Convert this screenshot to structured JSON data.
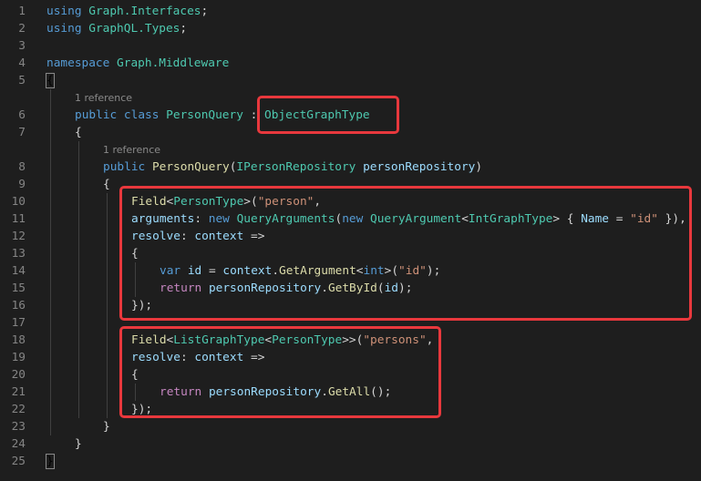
{
  "editor": {
    "highlight_color": "#e8383d",
    "rows": [
      {
        "n": "1",
        "indent": 0,
        "t": [
          [
            "kw",
            "using "
          ],
          [
            "ty",
            "Graph.Interfaces"
          ],
          [
            "pl",
            ";"
          ]
        ]
      },
      {
        "n": "2",
        "indent": 0,
        "t": [
          [
            "kw",
            "using "
          ],
          [
            "ty",
            "GraphQL.Types"
          ],
          [
            "pl",
            ";"
          ]
        ]
      },
      {
        "n": "3",
        "indent": 0,
        "t": []
      },
      {
        "n": "4",
        "indent": 0,
        "t": [
          [
            "kw",
            "namespace "
          ],
          [
            "ty",
            "Graph.Middleware"
          ]
        ]
      },
      {
        "n": "5",
        "indent": 0,
        "t": [
          [
            "bm",
            "{"
          ]
        ]
      },
      {
        "lens": "1 reference",
        "indent": 1
      },
      {
        "n": "6",
        "indent": 1,
        "t": [
          [
            "kw",
            "public class "
          ],
          [
            "ty",
            "PersonQuery"
          ],
          [
            "pl",
            " : "
          ],
          [
            "ty",
            "ObjectGraphType"
          ]
        ]
      },
      {
        "n": "7",
        "indent": 1,
        "t": [
          [
            "pl",
            "{"
          ]
        ]
      },
      {
        "lens": "1 reference",
        "indent": 2
      },
      {
        "n": "8",
        "indent": 2,
        "t": [
          [
            "kw",
            "public "
          ],
          [
            "fn",
            "PersonQuery"
          ],
          [
            "pl",
            "("
          ],
          [
            "ty",
            "IPersonRepository "
          ],
          [
            "var",
            "personRepository"
          ],
          [
            "pl",
            ")"
          ]
        ]
      },
      {
        "n": "9",
        "indent": 2,
        "t": [
          [
            "pl",
            "{"
          ]
        ]
      },
      {
        "n": "10",
        "indent": 3,
        "t": [
          [
            "fn",
            "Field"
          ],
          [
            "pl",
            "<"
          ],
          [
            "ty",
            "PersonType"
          ],
          [
            "pl",
            ">("
          ],
          [
            "str",
            "\"person\""
          ],
          [
            "pl",
            ","
          ]
        ]
      },
      {
        "n": "11",
        "indent": 3,
        "t": [
          [
            "var",
            "arguments"
          ],
          [
            "pl",
            ": "
          ],
          [
            "kw",
            "new "
          ],
          [
            "ty",
            "QueryArguments"
          ],
          [
            "pl",
            "("
          ],
          [
            "kw",
            "new "
          ],
          [
            "ty",
            "QueryArgument"
          ],
          [
            "pl",
            "<"
          ],
          [
            "ty",
            "IntGraphType"
          ],
          [
            "pl",
            "> { "
          ],
          [
            "var",
            "Name"
          ],
          [
            "pl",
            " = "
          ],
          [
            "str",
            "\"id\""
          ],
          [
            "pl",
            " }),"
          ]
        ]
      },
      {
        "n": "12",
        "indent": 3,
        "t": [
          [
            "var",
            "resolve"
          ],
          [
            "pl",
            ": "
          ],
          [
            "var",
            "context"
          ],
          [
            "pl",
            " =>"
          ]
        ]
      },
      {
        "n": "13",
        "indent": 3,
        "t": [
          [
            "pl",
            "{"
          ]
        ]
      },
      {
        "n": "14",
        "indent": 4,
        "t": [
          [
            "kw",
            "var "
          ],
          [
            "var",
            "id"
          ],
          [
            "pl",
            " = "
          ],
          [
            "var",
            "context"
          ],
          [
            "pl",
            "."
          ],
          [
            "fn",
            "GetArgument"
          ],
          [
            "pl",
            "<"
          ],
          [
            "kw",
            "int"
          ],
          [
            "pl",
            ">("
          ],
          [
            "str",
            "\"id\""
          ],
          [
            "pl",
            ");"
          ]
        ]
      },
      {
        "n": "15",
        "indent": 4,
        "t": [
          [
            "ctl",
            "return "
          ],
          [
            "var",
            "personRepository"
          ],
          [
            "pl",
            "."
          ],
          [
            "fn",
            "GetById"
          ],
          [
            "pl",
            "("
          ],
          [
            "var",
            "id"
          ],
          [
            "pl",
            ");"
          ]
        ]
      },
      {
        "n": "16",
        "indent": 3,
        "t": [
          [
            "pl",
            "});"
          ]
        ]
      },
      {
        "n": "17",
        "indent": 3,
        "t": []
      },
      {
        "n": "18",
        "indent": 3,
        "t": [
          [
            "fn",
            "Field"
          ],
          [
            "pl",
            "<"
          ],
          [
            "ty",
            "ListGraphType"
          ],
          [
            "pl",
            "<"
          ],
          [
            "ty",
            "PersonType"
          ],
          [
            "pl",
            ">>("
          ],
          [
            "str",
            "\"persons\""
          ],
          [
            "pl",
            ","
          ]
        ]
      },
      {
        "n": "19",
        "indent": 3,
        "t": [
          [
            "var",
            "resolve"
          ],
          [
            "pl",
            ": "
          ],
          [
            "var",
            "context"
          ],
          [
            "pl",
            " =>"
          ]
        ]
      },
      {
        "n": "20",
        "indent": 3,
        "t": [
          [
            "pl",
            "{"
          ]
        ]
      },
      {
        "n": "21",
        "indent": 4,
        "t": [
          [
            "ctl",
            "return "
          ],
          [
            "var",
            "personRepository"
          ],
          [
            "pl",
            "."
          ],
          [
            "fn",
            "GetAll"
          ],
          [
            "pl",
            "();"
          ]
        ]
      },
      {
        "n": "22",
        "indent": 3,
        "t": [
          [
            "pl",
            "});"
          ]
        ]
      },
      {
        "n": "23",
        "indent": 2,
        "t": [
          [
            "pl",
            "}"
          ]
        ]
      },
      {
        "n": "24",
        "indent": 1,
        "t": [
          [
            "pl",
            "}"
          ]
        ]
      },
      {
        "n": "25",
        "indent": 0,
        "t": [
          [
            "bm",
            "}"
          ]
        ]
      }
    ]
  }
}
